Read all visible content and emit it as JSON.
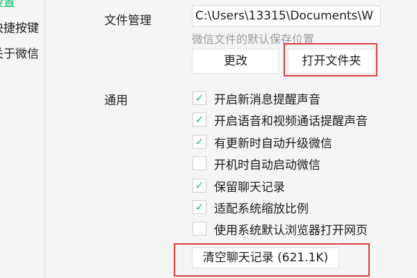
{
  "sidebar": {
    "items": [
      {
        "label": "设置"
      },
      {
        "label": "快捷按键"
      },
      {
        "label": "关于微信"
      }
    ]
  },
  "file_management": {
    "label": "文件管理",
    "path_value": "C:\\Users\\13315\\Documents\\W",
    "caption": "微信文件的默认保存位置",
    "change_button": "更改",
    "open_folder_button": "打开文件夹"
  },
  "general": {
    "label": "通用",
    "options": [
      {
        "label": "开启新消息提醒声音",
        "checked": true
      },
      {
        "label": "开启语音和视频通话提醒声音",
        "checked": true
      },
      {
        "label": "有更新时自动升级微信",
        "checked": true
      },
      {
        "label": "开机时自动启动微信",
        "checked": false
      },
      {
        "label": "保留聊天记录",
        "checked": true
      },
      {
        "label": "适配系统缩放比例",
        "checked": true
      },
      {
        "label": "使用系统默认浏览器打开网页",
        "checked": false
      }
    ],
    "clear_history_button": "清空聊天记录 (621.1K)"
  },
  "colors": {
    "accent": "#07c160",
    "highlight": "#e03c3c"
  }
}
